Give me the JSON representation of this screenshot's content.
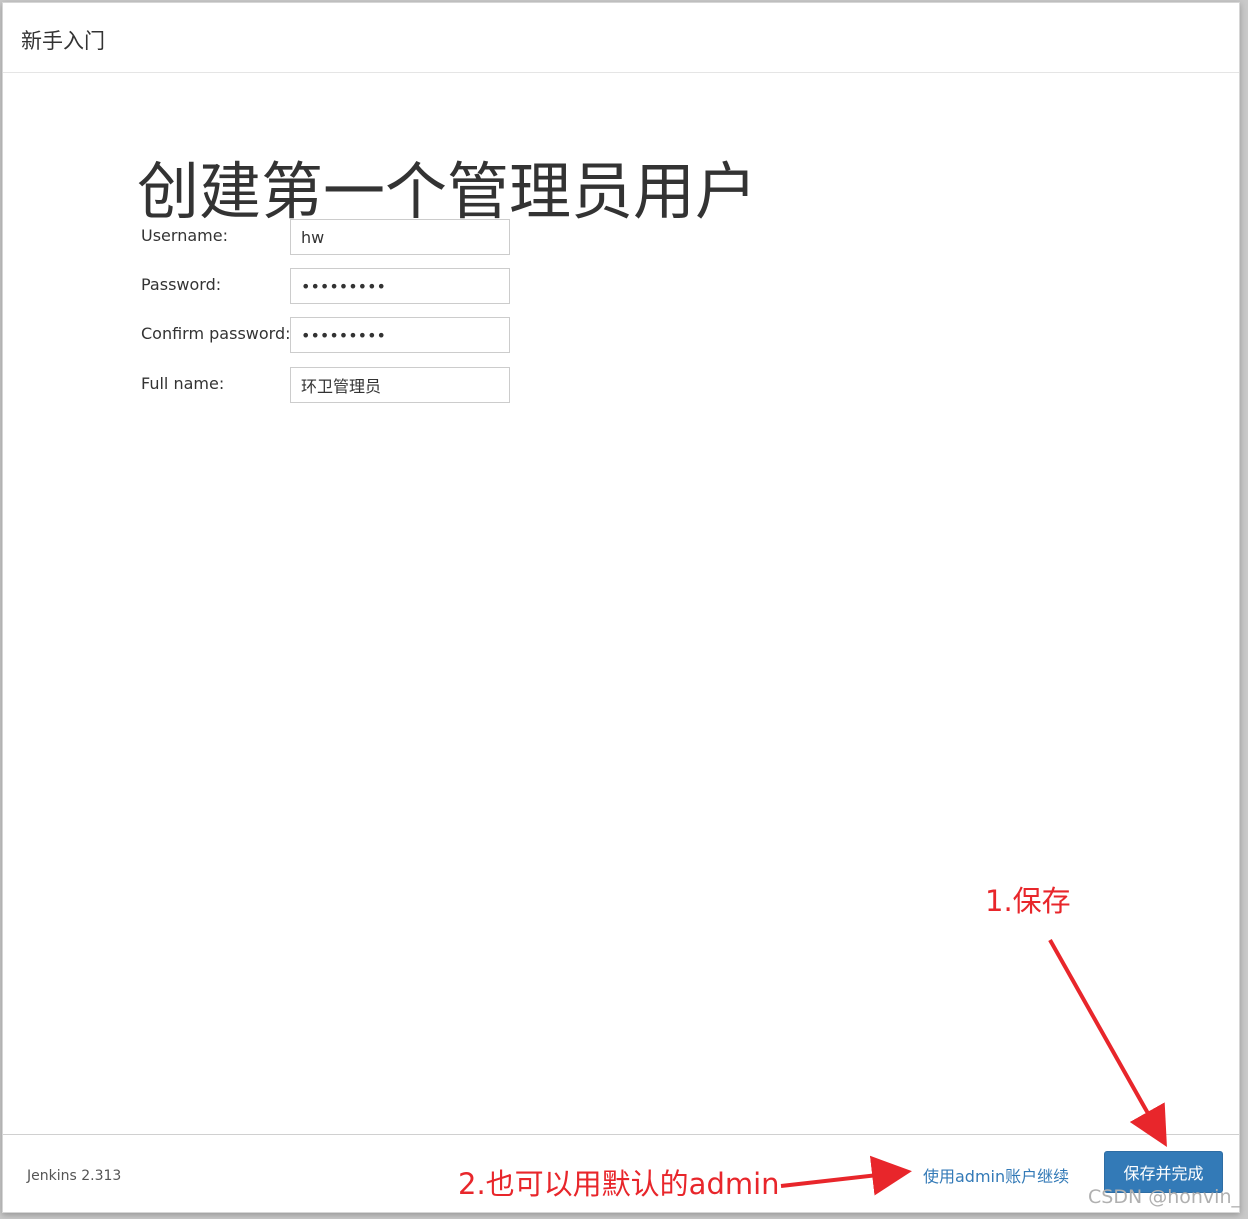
{
  "header": {
    "title": "新手入门"
  },
  "page": {
    "heading": "创建第一个管理员用户"
  },
  "form": {
    "fields": [
      {
        "label": "Username:",
        "value": "hw",
        "type": "text"
      },
      {
        "label": "Password:",
        "value": "•••••••••",
        "type": "password"
      },
      {
        "label": "Confirm password:",
        "value": "•••••••••",
        "type": "password"
      },
      {
        "label": "Full name:",
        "value": "环卫管理员",
        "type": "text"
      }
    ]
  },
  "footer": {
    "version": "Jenkins 2.313",
    "admin_link_label": "使用admin账户继续",
    "save_button_label": "保存并完成"
  },
  "annotations": {
    "save_note": "1.保存",
    "admin_note": "2.也可以用默认的admin",
    "color": "#e8262b"
  },
  "watermark": "CSDN @honvin_",
  "colors": {
    "primary": "#337ab7",
    "link": "#337ab7"
  }
}
